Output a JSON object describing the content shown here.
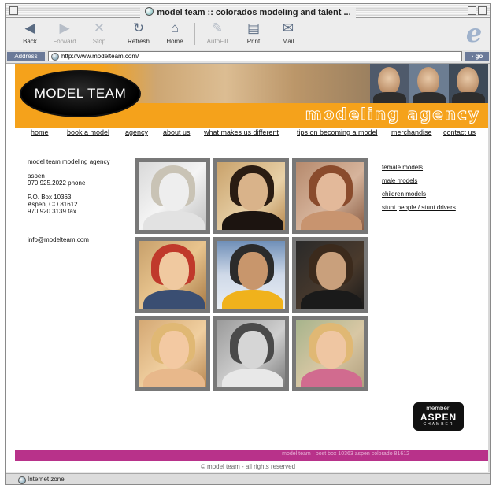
{
  "window": {
    "title": "model team :: colorados modeling and talent ..."
  },
  "toolbar": {
    "back": "Back",
    "forward": "Forward",
    "stop": "Stop",
    "refresh": "Refresh",
    "home": "Home",
    "autofill": "AutoFill",
    "print": "Print",
    "mail": "Mail"
  },
  "address": {
    "label": "Address",
    "url": "http://www.modelteam.com/",
    "go": "go"
  },
  "banner": {
    "logo": "MODEL TEAM",
    "tagline": "modeling agency"
  },
  "nav": [
    "home",
    "book a model",
    "agency",
    "about us",
    "what makes us different",
    "tips on becoming a model",
    "merchandise",
    "contact us"
  ],
  "contact": {
    "company": "model team modeling agency",
    "city": "aspen",
    "phone": "970.925.2022 phone",
    "box": "P.O. Box 10363",
    "citystate": "Aspen, CO 81612",
    "fax": "970.920.3139 fax",
    "email": "info@modelteam.com"
  },
  "categories": [
    "female models",
    "male models",
    "children models",
    "stunt people / stunt drivers"
  ],
  "badge": {
    "member": "member:",
    "name": "ASPEN",
    "sub": "CHAMBER"
  },
  "footer": {
    "bar_text": "model team · post box 10363 aspen colorado 81612",
    "copyright": "© model team - all rights reserved"
  },
  "status": {
    "zone": "Internet zone"
  },
  "icons": [
    "back-icon",
    "forward-icon",
    "stop-icon",
    "refresh-icon",
    "home-icon",
    "autofill-icon",
    "print-icon",
    "mail-icon",
    "ie-logo-icon",
    "globe-icon"
  ],
  "colors": {
    "brand_orange": "#f5a21b",
    "footer_magenta": "#b8328a"
  }
}
